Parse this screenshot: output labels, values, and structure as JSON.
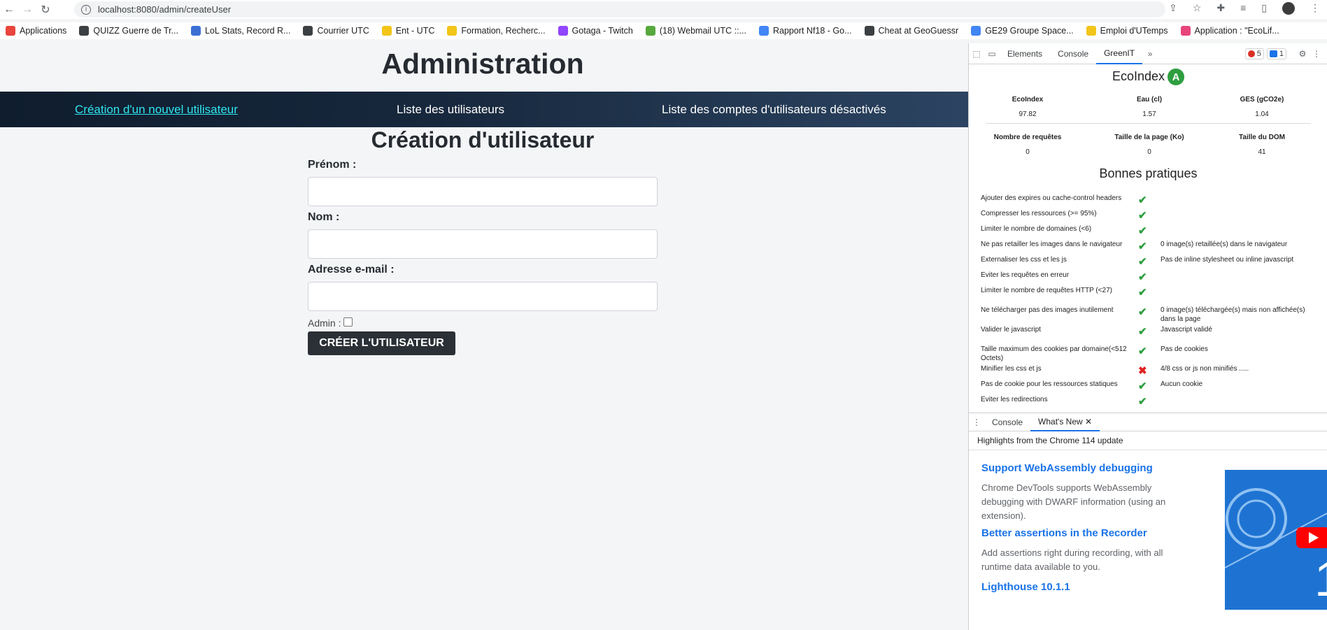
{
  "browser": {
    "url": "localhost:8080/admin/createUser",
    "bookmarks": [
      {
        "label": "Applications",
        "color": "#e8453c"
      },
      {
        "label": "QUIZZ Guerre de Tr...",
        "color": "#3c4043"
      },
      {
        "label": "LoL Stats, Record R...",
        "color": "#3b6fd4"
      },
      {
        "label": "Courrier  UTC",
        "color": "#3c4043"
      },
      {
        "label": "Ent - UTC",
        "color": "#f2c518"
      },
      {
        "label": "Formation, Recherc...",
        "color": "#f2c518"
      },
      {
        "label": "Gotaga - Twitch",
        "color": "#9146ff"
      },
      {
        "label": "(18) Webmail UTC ::...",
        "color": "#57a83d"
      },
      {
        "label": "Rapport Nf18 - Go...",
        "color": "#4285f4"
      },
      {
        "label": "Cheat at GeoGuessr",
        "color": "#3c4043"
      },
      {
        "label": "GE29 Groupe Space...",
        "color": "#4285f4"
      },
      {
        "label": "Emploi d'UTemps",
        "color": "#f2c518"
      },
      {
        "label": "Application : \"EcoLif...",
        "color": "#e8457c"
      }
    ]
  },
  "page": {
    "title": "Administration",
    "nav": {
      "create": "Création d'un nouvel utilisateur",
      "list": "Liste des utilisateurs",
      "disabled": "Liste des comptes d'utilisateurs désactivés"
    },
    "form": {
      "title": "Création d'utilisateur",
      "firstname_label": "Prénom :",
      "firstname_value": "",
      "lastname_label": "Nom :",
      "lastname_value": "",
      "email_label": "Adresse e-mail :",
      "email_value": "",
      "admin_label": "Admin :",
      "admin_checked": false,
      "submit": "CRÉER L'UTILISATEUR"
    }
  },
  "devtools": {
    "tabs": [
      "Elements",
      "Console",
      "GreenIT"
    ],
    "active_tab": "GreenIT",
    "errors": "5",
    "messages": "1",
    "ecoindex_title": "EcoIndex",
    "grade": "A",
    "grade_color": "#2e9e3f",
    "metrics_top": [
      {
        "label": "EcoIndex",
        "value": "97.82"
      },
      {
        "label": "Eau (cl)",
        "value": "1.57"
      },
      {
        "label": "GES (gCO2e)",
        "value": "1.04"
      }
    ],
    "metrics_bottom": [
      {
        "label": "Nombre de requêtes",
        "value": "0"
      },
      {
        "label": "Taille de la page (Ko)",
        "value": "0"
      },
      {
        "label": "Taille du DOM",
        "value": "41"
      }
    ],
    "best_practices_title": "Bonnes pratiques",
    "best_practices": [
      {
        "name": "Ajouter des expires ou cache-control headers",
        "ok": true,
        "comment": ""
      },
      {
        "name": "Compresser les ressources (>= 95%)",
        "ok": true,
        "comment": ""
      },
      {
        "name": "Limiter le nombre de domaines (<6)",
        "ok": true,
        "comment": ""
      },
      {
        "name": "Ne pas retailler les images dans le navigateur",
        "ok": true,
        "comment": "0 image(s) retaillée(s) dans le navigateur"
      },
      {
        "name": "Externaliser les css et les js",
        "ok": true,
        "comment": "Pas de inline stylesheet ou inline javascript"
      },
      {
        "name": "Eviter les requêtes en erreur",
        "ok": true,
        "comment": ""
      },
      {
        "name": "Limiter le nombre de requêtes HTTP (<27)",
        "ok": true,
        "comment": ""
      },
      {
        "name": "Ne télécharger pas des images inutilement",
        "ok": true,
        "comment": "0 image(s) téléchargée(s) mais non affichée(s) dans la page"
      },
      {
        "name": "Valider le javascript",
        "ok": true,
        "comment": "Javascript validé"
      },
      {
        "name": "Taille maximum des cookies par domaine(<512 Octets)",
        "ok": true,
        "comment": "Pas de cookies"
      },
      {
        "name": "Minifier les css et js",
        "ok": false,
        "comment": "4/8 css or js non minifiés ....."
      },
      {
        "name": "Pas de cookie pour les ressources statiques",
        "ok": true,
        "comment": "Aucun cookie"
      },
      {
        "name": "Eviter les redirections",
        "ok": true,
        "comment": ""
      }
    ],
    "drawer": {
      "tabs": [
        "Console",
        "What's New"
      ],
      "subtitle": "Highlights from the Chrome 114 update",
      "items": [
        {
          "title": "Support WebAssembly debugging",
          "desc": "Chrome DevTools supports WebAssembly debugging with DWARF information (using an extension)."
        },
        {
          "title": "Better assertions in the Recorder",
          "desc": "Add assertions right during recording, with all runtime data available to you."
        },
        {
          "title": "Lighthouse 10.1.1",
          "desc": ""
        }
      ]
    }
  }
}
